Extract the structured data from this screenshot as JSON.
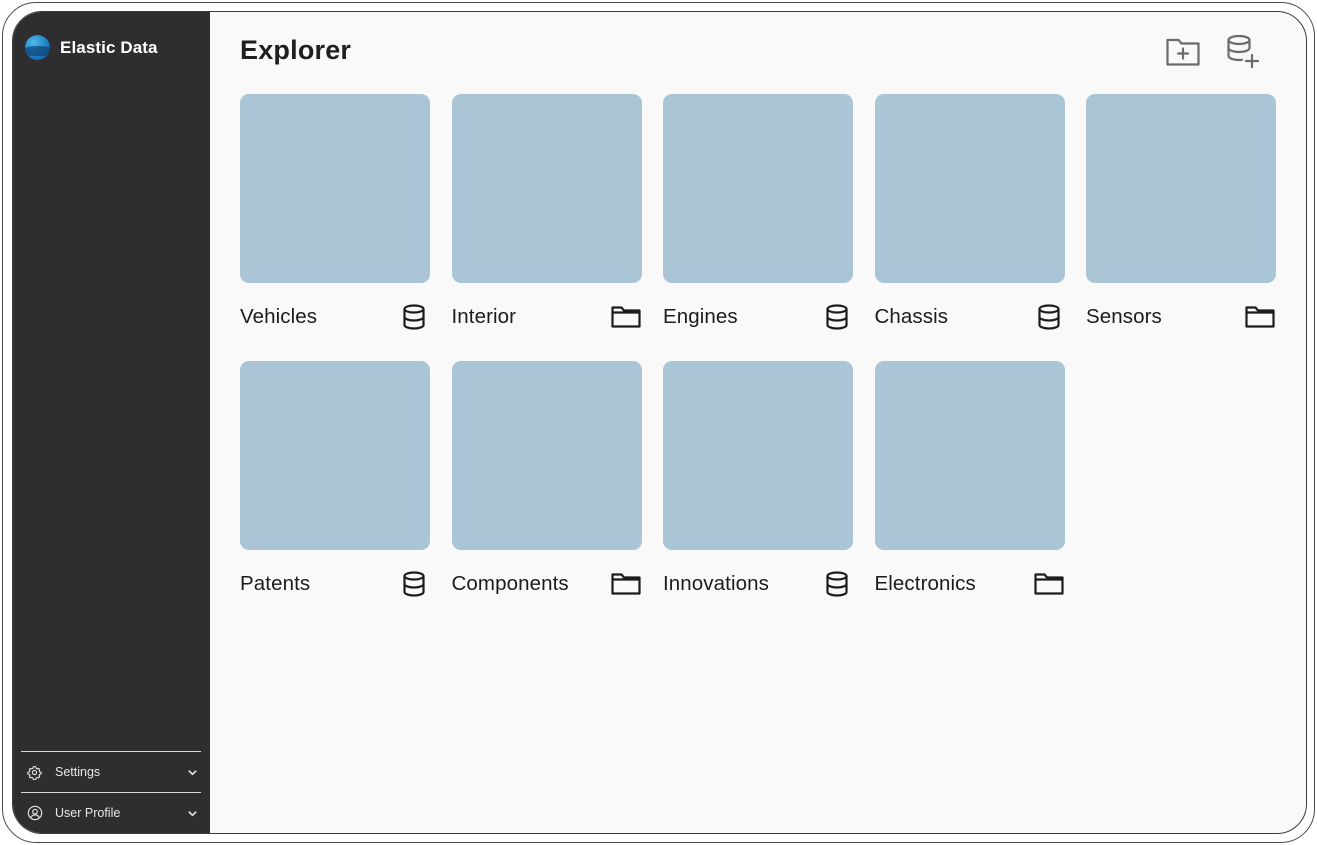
{
  "app": {
    "brand_name": "Elastic Data",
    "brand_logo_icon": "globe-logo-icon"
  },
  "sidebar": {
    "bottom_items": [
      {
        "label": "Settings",
        "icon": "gear-icon"
      },
      {
        "label": "User Profile",
        "icon": "user-circle-icon"
      }
    ]
  },
  "main": {
    "title": "Explorer",
    "toolbar": {
      "new_folder_icon": "folder-plus-icon",
      "new_database_icon": "database-plus-icon"
    },
    "items": [
      {
        "name": "Vehicles",
        "type": "database"
      },
      {
        "name": "Interior",
        "type": "folder"
      },
      {
        "name": "Engines",
        "type": "database"
      },
      {
        "name": "Chassis",
        "type": "database"
      },
      {
        "name": "Sensors",
        "type": "folder"
      },
      {
        "name": "Patents",
        "type": "database"
      },
      {
        "name": "Components",
        "type": "folder"
      },
      {
        "name": "Innovations",
        "type": "database"
      },
      {
        "name": "Electronics",
        "type": "folder"
      }
    ]
  },
  "colors": {
    "sidebar_bg": "#2e2e30",
    "main_bg": "#f9f9f9",
    "thumbnail": "#a9c5d6",
    "text": "#1c1c1c"
  }
}
